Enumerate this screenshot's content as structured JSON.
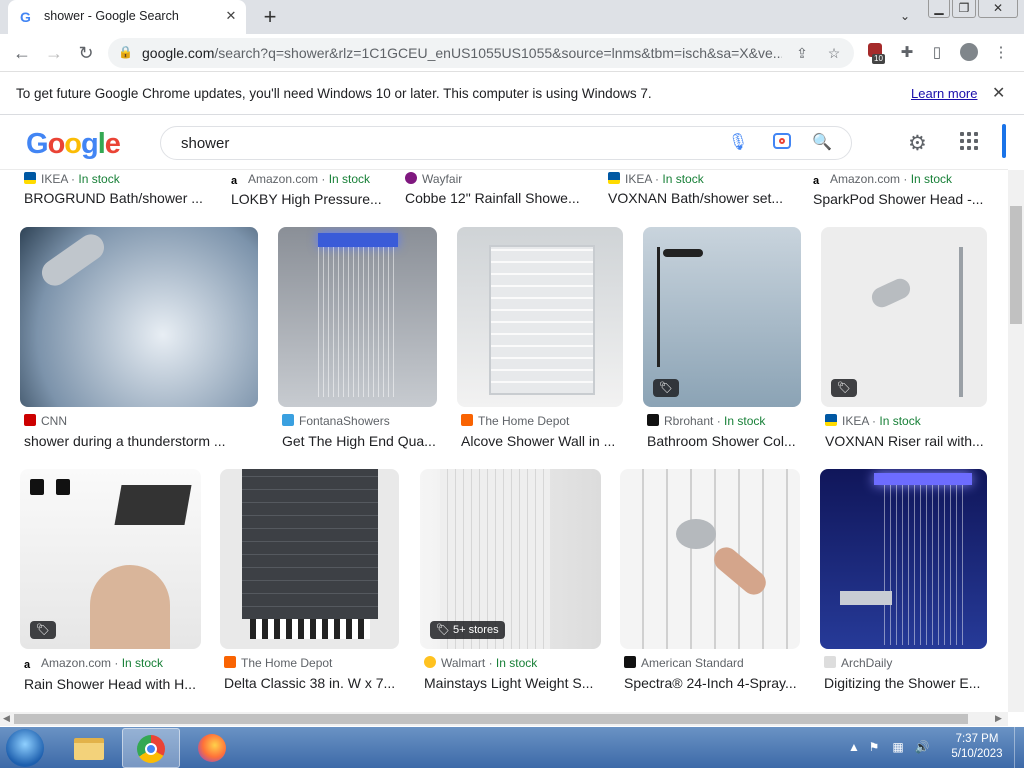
{
  "browser": {
    "tab_title": "shower - Google Search",
    "tab_favicon": "G",
    "new_tab_icon": "+",
    "url_host": "google.com",
    "url_rest": "/search?q=shower&rlz=1C1GCEU_enUS1055US1055&source=lnms&tbm=isch&sa=X&ve...",
    "extension_badge": "10"
  },
  "infobar": {
    "message": "To get future Google Chrome updates, you'll need Windows 10 or later. This computer is using Windows 7.",
    "learn_more": "Learn more"
  },
  "google": {
    "logo": "Google",
    "query": "shower"
  },
  "top_row": [
    {
      "source": "IKEA",
      "stock": "In stock",
      "title": "BROGRUND Bath/shower ..."
    },
    {
      "source": "Amazon.com",
      "stock": "In stock",
      "title": "LOKBY High Pressure..."
    },
    {
      "source": "Wayfair",
      "stock": "",
      "title": "Cobbe 12\" Rainfall Showe..."
    },
    {
      "source": "IKEA",
      "stock": "In stock",
      "title": "VOXNAN Bath/shower set..."
    },
    {
      "source": "Amazon.com",
      "stock": "In stock",
      "title": "SparkPod Shower Head -..."
    }
  ],
  "row1": [
    {
      "source": "CNN",
      "stock": "",
      "title": "shower during a thunderstorm ..."
    },
    {
      "source": "FontanaShowers",
      "stock": "",
      "title": "Get The High End Qua..."
    },
    {
      "source": "The Home Depot",
      "stock": "",
      "title": "Alcove Shower Wall in ..."
    },
    {
      "source": "Rbrohant",
      "stock": "In stock",
      "title": "Bathroom Shower Col..."
    },
    {
      "source": "IKEA",
      "stock": "In stock",
      "title": "VOXNAN Riser rail with..."
    }
  ],
  "row2": [
    {
      "source": "Amazon.com",
      "stock": "In stock",
      "title": "Rain Shower Head with H..."
    },
    {
      "source": "The Home Depot",
      "stock": "",
      "title": "Delta Classic 38 in. W x 7..."
    },
    {
      "source": "Walmart",
      "stock": "In stock",
      "title": "Mainstays Light Weight S..."
    },
    {
      "source": "American Standard",
      "stock": "",
      "title": "Spectra® 24-Inch 4-Spray..."
    },
    {
      "source": "ArchDaily",
      "stock": "",
      "title": "Digitizing the Shower E..."
    }
  ],
  "badges": {
    "stores": "5+ stores"
  },
  "taskbar": {
    "time": "7:37 PM",
    "date": "5/10/2023"
  },
  "colors": {
    "google_blue": "#4285f4",
    "google_red": "#ea4335",
    "google_yellow": "#fbbc05",
    "google_green": "#34a853",
    "in_stock_green": "#188038",
    "link_blue": "#1a0dab"
  }
}
